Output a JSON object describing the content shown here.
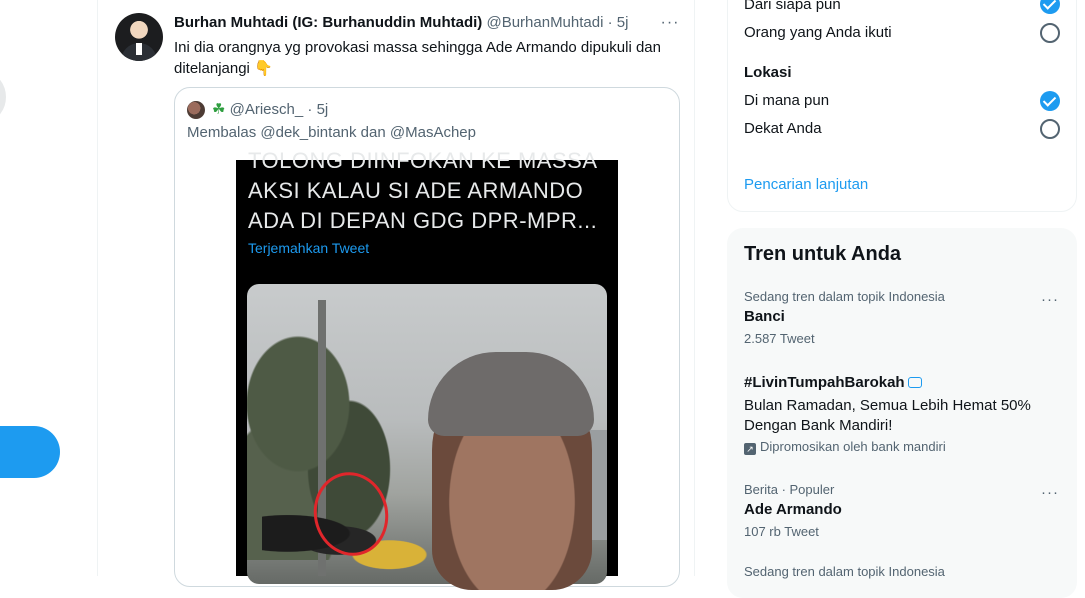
{
  "tweet": {
    "author_name": "Burhan Muhtadi (IG: Burhanuddin Muhtadi)",
    "handle": "@BurhanMuhtadi",
    "separator": "·",
    "time": "5j",
    "more": "···",
    "text_line1": "Ini dia orangnya yg provokasi massa sehingga Ade Armando dipukuli dan",
    "text_line2": "ditelanjangi",
    "emoji": "👇"
  },
  "quote": {
    "emoji": "☘",
    "handle": "@Ariesch_",
    "separator": "·",
    "time": "5j",
    "reply_prefix": "Membalas",
    "reply_user1": "@dek_bintank",
    "reply_and": "dan",
    "reply_user2": "@MasAchep",
    "media_text": [
      "TOLONG DIINFOKAN KE MASSA",
      "AKSI KALAU SI ADE ARMANDO",
      "ADA DI DEPAN GDG DPR-MPR..."
    ],
    "media_translate": "Terjemahkan Tweet"
  },
  "filters": {
    "people_option_any": "Dari siapa pun",
    "people_option_following": "Orang yang Anda ikuti",
    "location_label": "Lokasi",
    "location_option_anywhere": "Di mana pun",
    "location_option_near": "Dekat Anda",
    "advanced_search": "Pencarian lanjutan",
    "selected": {
      "people": "Dari siapa pun",
      "location": "Di mana pun"
    }
  },
  "trends": {
    "title": "Tren untuk Anda",
    "items": [
      {
        "meta": "Sedang tren dalam topik Indonesia",
        "name": "Banci",
        "count": "2.587 Tweet"
      },
      {
        "name": "#LivinTumpahBarokah",
        "description": "Bulan Ramadan, Semua Lebih Hemat 50% Dengan Bank Mandiri!",
        "promoted": "Dipromosikan oleh bank mandiri"
      },
      {
        "meta": "Berita · Populer",
        "name": "Ade Armando",
        "count": "107 rb Tweet"
      },
      {
        "meta": "Sedang tren dalam topik Indonesia"
      }
    ]
  },
  "colors": {
    "accent": "#1d9bf0",
    "text": "#0f1419",
    "muted": "#536471",
    "annotation": "#e0262b"
  }
}
